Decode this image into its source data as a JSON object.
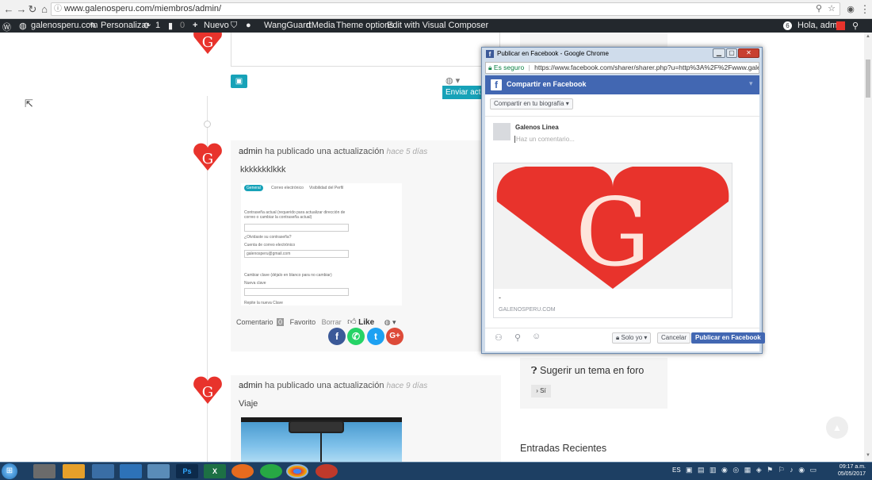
{
  "browser": {
    "url": "www.galenosperu.com/miembros/admin/"
  },
  "adminbar": {
    "site": "galenosperu.com",
    "customize": "Personalizar",
    "updates": "1",
    "comments": "0",
    "new": "Nuevo",
    "wangguard": "WangGuard",
    "rtmedia": "rtMedia",
    "theme_options": "Theme options",
    "visual_composer": "Edit with Visual Composer",
    "greeting": "Hola, admin"
  },
  "feed": {
    "send_button": "Enviar actual",
    "post1": {
      "author": "admin",
      "action": "ha publicado una actualización",
      "time": "hace 5 días",
      "text": "kkkkkkklkkk",
      "shot": {
        "tab_general": "General",
        "tab_email": "Correo electrónico",
        "tab_visibility": "Visibilidad del Perfil",
        "current_pw": "Contraseña actual (requerido para actualizar dirección de correo o cambiar la contraseña actual)",
        "forgot": "¿Olvidaste su contraseña?",
        "email_label": "Cuenta de correo electrónico",
        "email_value": "galenosperu@gmail.com",
        "change_pw": "Cambiar clave (déjalo en blanco para no cambiar)",
        "new_pw": "Nueva clave",
        "repeat_pw": "Repite la nueva Clave"
      },
      "actions": {
        "comment": "Comentario",
        "comment_count": "0",
        "favorite": "Favorito",
        "delete": "Borrar",
        "like": "Like"
      }
    },
    "post2": {
      "author": "admin",
      "action": "ha publicado una actualización",
      "time": "hace 9 días",
      "text": "Viaje"
    }
  },
  "sidebar": {
    "suggest": "Sugerir un tema en foro",
    "suggest_btn": "› Sí",
    "recent": "Entradas Recientes"
  },
  "popup": {
    "window_title": "Publicar en Facebook - Google Chrome",
    "secure": "Es seguro",
    "url": "https://www.facebook.com/sharer/sharer.php?u=http%3A%2F%2Fwww.galenos",
    "header": "Compartir en Facebook",
    "share_target": "Compartir en tu biografía",
    "user": "Galenos Linea",
    "comment_placeholder": "Haz un comentario...",
    "preview_title": "-",
    "preview_domain": "GALENOSPERU.COM",
    "privacy": "Solo yo",
    "cancel": "Cancelar",
    "publish": "Publicar en Facebook"
  },
  "taskbar": {
    "lang": "ES",
    "time": "09:17 a.m.",
    "date": "05/05/2017"
  },
  "colors": {
    "fb_blue": "#4267b2",
    "heart_red": "#e8332c",
    "wp_bar": "#23282d"
  }
}
